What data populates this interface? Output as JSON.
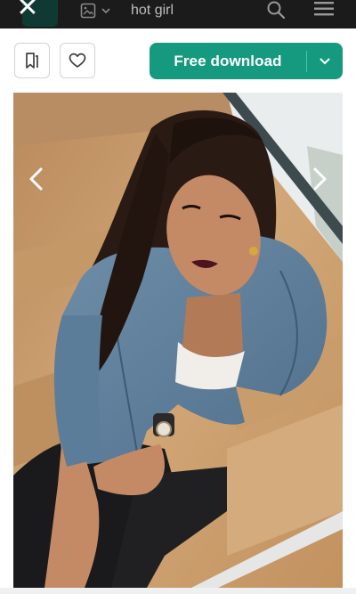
{
  "topbar": {
    "close_icon": "close-icon",
    "search_value": "hot girl",
    "search_icon": "search-icon",
    "menu_icon": "hamburger-menu-icon",
    "asset_type_icon": "image-icon"
  },
  "actions": {
    "collect_icon": "bookmark-icon",
    "like_icon": "heart-icon",
    "download_label": "Free download",
    "download_options_icon": "chevron-down-icon"
  },
  "colors": {
    "topbar": "#1b1b1b",
    "accent": "#159a80",
    "accent_divider": "#4fc0a9",
    "border": "#cfd4d9"
  },
  "photo": {
    "subject": "woman in denim jacket sitting on wooden stairs",
    "prev_icon": "chevron-left-icon",
    "next_icon": "chevron-right-icon"
  }
}
